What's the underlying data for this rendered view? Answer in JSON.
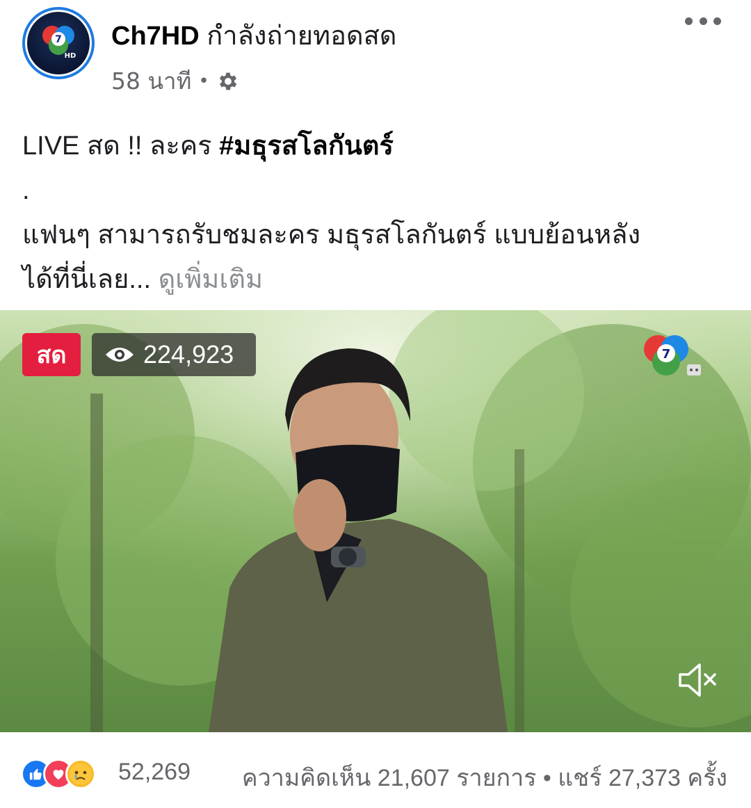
{
  "post": {
    "page_name": "Ch7HD",
    "activity": "กำลังถ่ายทอดสด",
    "time": "58 นาที",
    "privacy_icon": "gear-icon",
    "more_icon": "more-icon",
    "text_line1_prefix": "LIVE สด !! ละคร ",
    "hashtag": "#มธุรสโลกันตร์",
    "text_line2": ".",
    "text_line3": "แฟนๆ สามารถรับชมละคร มธุรสโลกันตร์ แบบย้อนหลัง",
    "text_line4": "ได้ที่นี่เลย...",
    "see_more": "ดูเพิ่มเติม"
  },
  "video": {
    "live_label": "สด",
    "viewer_count": "224,923",
    "mute_icon": "mute-icon",
    "channel_logo": "ch7-logo"
  },
  "footer": {
    "reactions": [
      "like-icon",
      "love-icon",
      "sad-icon"
    ],
    "reaction_count": "52,269",
    "engagement": "ความคิดเห็น 21,607 รายการ • แชร์ 27,373 ครั้ง"
  },
  "colors": {
    "live_red": "#e41e3f",
    "like_blue": "#1877f2",
    "love_red": "#f33e58",
    "meta_gray": "#65676b"
  }
}
